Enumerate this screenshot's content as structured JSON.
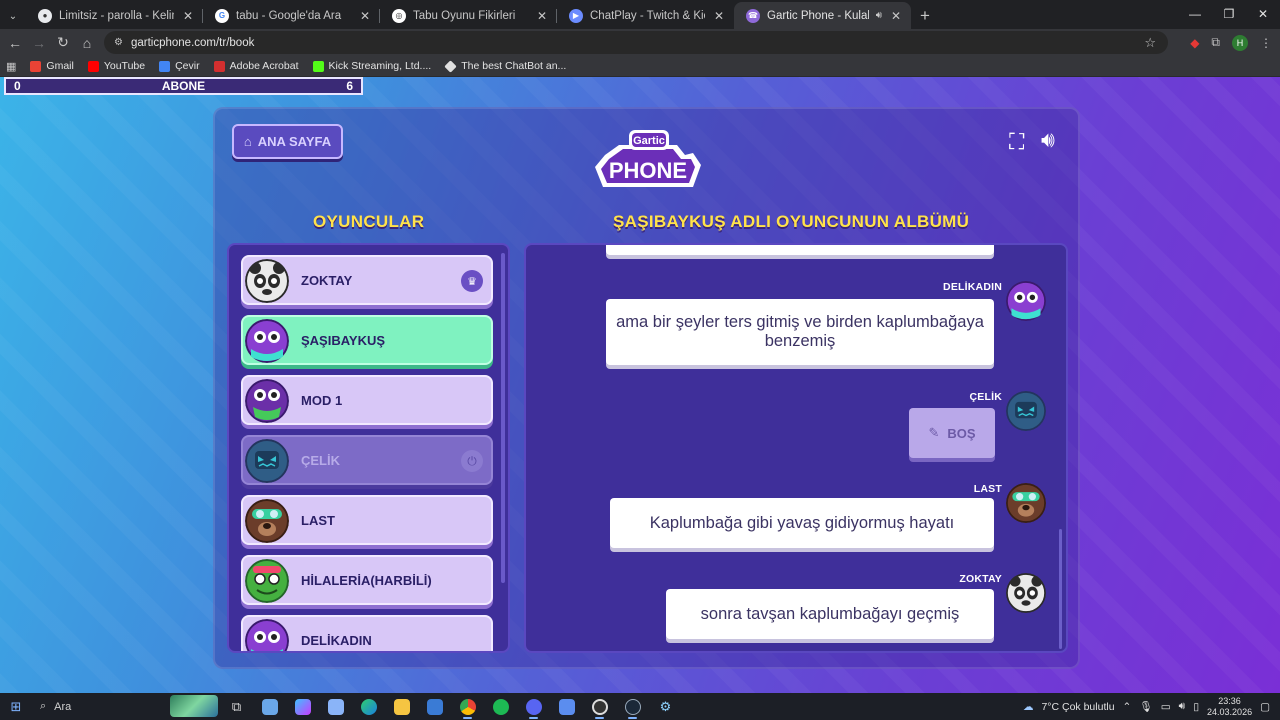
{
  "browser": {
    "tabs": [
      {
        "title": "Limitsiz - parolla - Kelime oyunu",
        "fav": "parolla-icon",
        "active": false
      },
      {
        "title": "tabu - Google'da Ara",
        "fav": "google-icon",
        "active": false
      },
      {
        "title": "Tabu Oyunu Fikirleri",
        "fav": "chatgpt-icon",
        "active": false
      },
      {
        "title": "ChatPlay - Twitch & Kick İzleyici",
        "fav": "chatplay-icon",
        "active": false
      },
      {
        "title": "Gartic Phone - Kulaktan Kulağa",
        "fav": "gartic-icon",
        "active": true
      }
    ],
    "url": "garticphone.com/tr/book",
    "profile_initial": "H",
    "bookmarks": [
      {
        "label": "Gmail",
        "color": "#ea4335"
      },
      {
        "label": "YouTube",
        "color": "#ff0000"
      },
      {
        "label": "Çevir",
        "color": "#4285f4"
      },
      {
        "label": "Adobe Acrobat",
        "color": "#d32f2f"
      },
      {
        "label": "Kick Streaming, Ltd....",
        "color": "#53fc18"
      },
      {
        "label": "The best ChatBot an...",
        "color": "#e0e0e0"
      }
    ]
  },
  "overlay": {
    "left": "0",
    "center": "ABONE",
    "right": "6"
  },
  "game": {
    "home_label": "ANA SAYFA",
    "logo_top": "Gartic",
    "logo_bottom": "PHONE",
    "players_title": "OYUNCULAR",
    "album_title": "ŞAŞIBAYKUŞ ADLI OYUNCUNUN ALBÜMÜ",
    "players": [
      {
        "name": "ZOKTAY",
        "state": "host",
        "avatar_color": "#f2f2f2",
        "accent": "#2b2b2b"
      },
      {
        "name": "ŞAŞIBAYKUŞ",
        "state": "active",
        "avatar_color": "#8a3fd1",
        "accent": "#3ee0d0"
      },
      {
        "name": "MOD 1",
        "state": "normal",
        "avatar_color": "#6b2fa8",
        "accent": "#45c95a"
      },
      {
        "name": "ÇELİK",
        "state": "left",
        "avatar_color": "#244d7a",
        "accent": "#36c6d6"
      },
      {
        "name": "LAST",
        "state": "normal",
        "avatar_color": "#6b3d2a",
        "accent": "#38d0a0"
      },
      {
        "name": "HİLALERİA(HARBİLİ)",
        "state": "normal",
        "avatar_color": "#45b040",
        "accent": "#f2486d"
      },
      {
        "name": "DELİKADIN",
        "state": "normal",
        "avatar_color": "#8a3fd1",
        "accent": "#3ee0d0"
      }
    ],
    "album": [
      {
        "user": "DELİKADIN",
        "text": "ama bir şeyler ters gitmiş ve birden kaplumbağaya benzemiş",
        "avatar_color": "#8a3fd1"
      },
      {
        "user": "ÇELİK",
        "empty_label": "BOŞ",
        "avatar_color": "#244d7a"
      },
      {
        "user": "LAST",
        "text": "Kaplumbağa gibi yavaş gidiyormuş hayatı",
        "avatar_color": "#6b3d2a"
      },
      {
        "user": "ZOKTAY",
        "text": "sonra tavşan kaplumbağayı geçmiş",
        "avatar_color": "#f2f2f2"
      }
    ]
  },
  "taskbar": {
    "search_placeholder": "Ara",
    "weather": "7°C  Çok bulutlu",
    "time": "23:36",
    "date": "24.03.2026"
  }
}
